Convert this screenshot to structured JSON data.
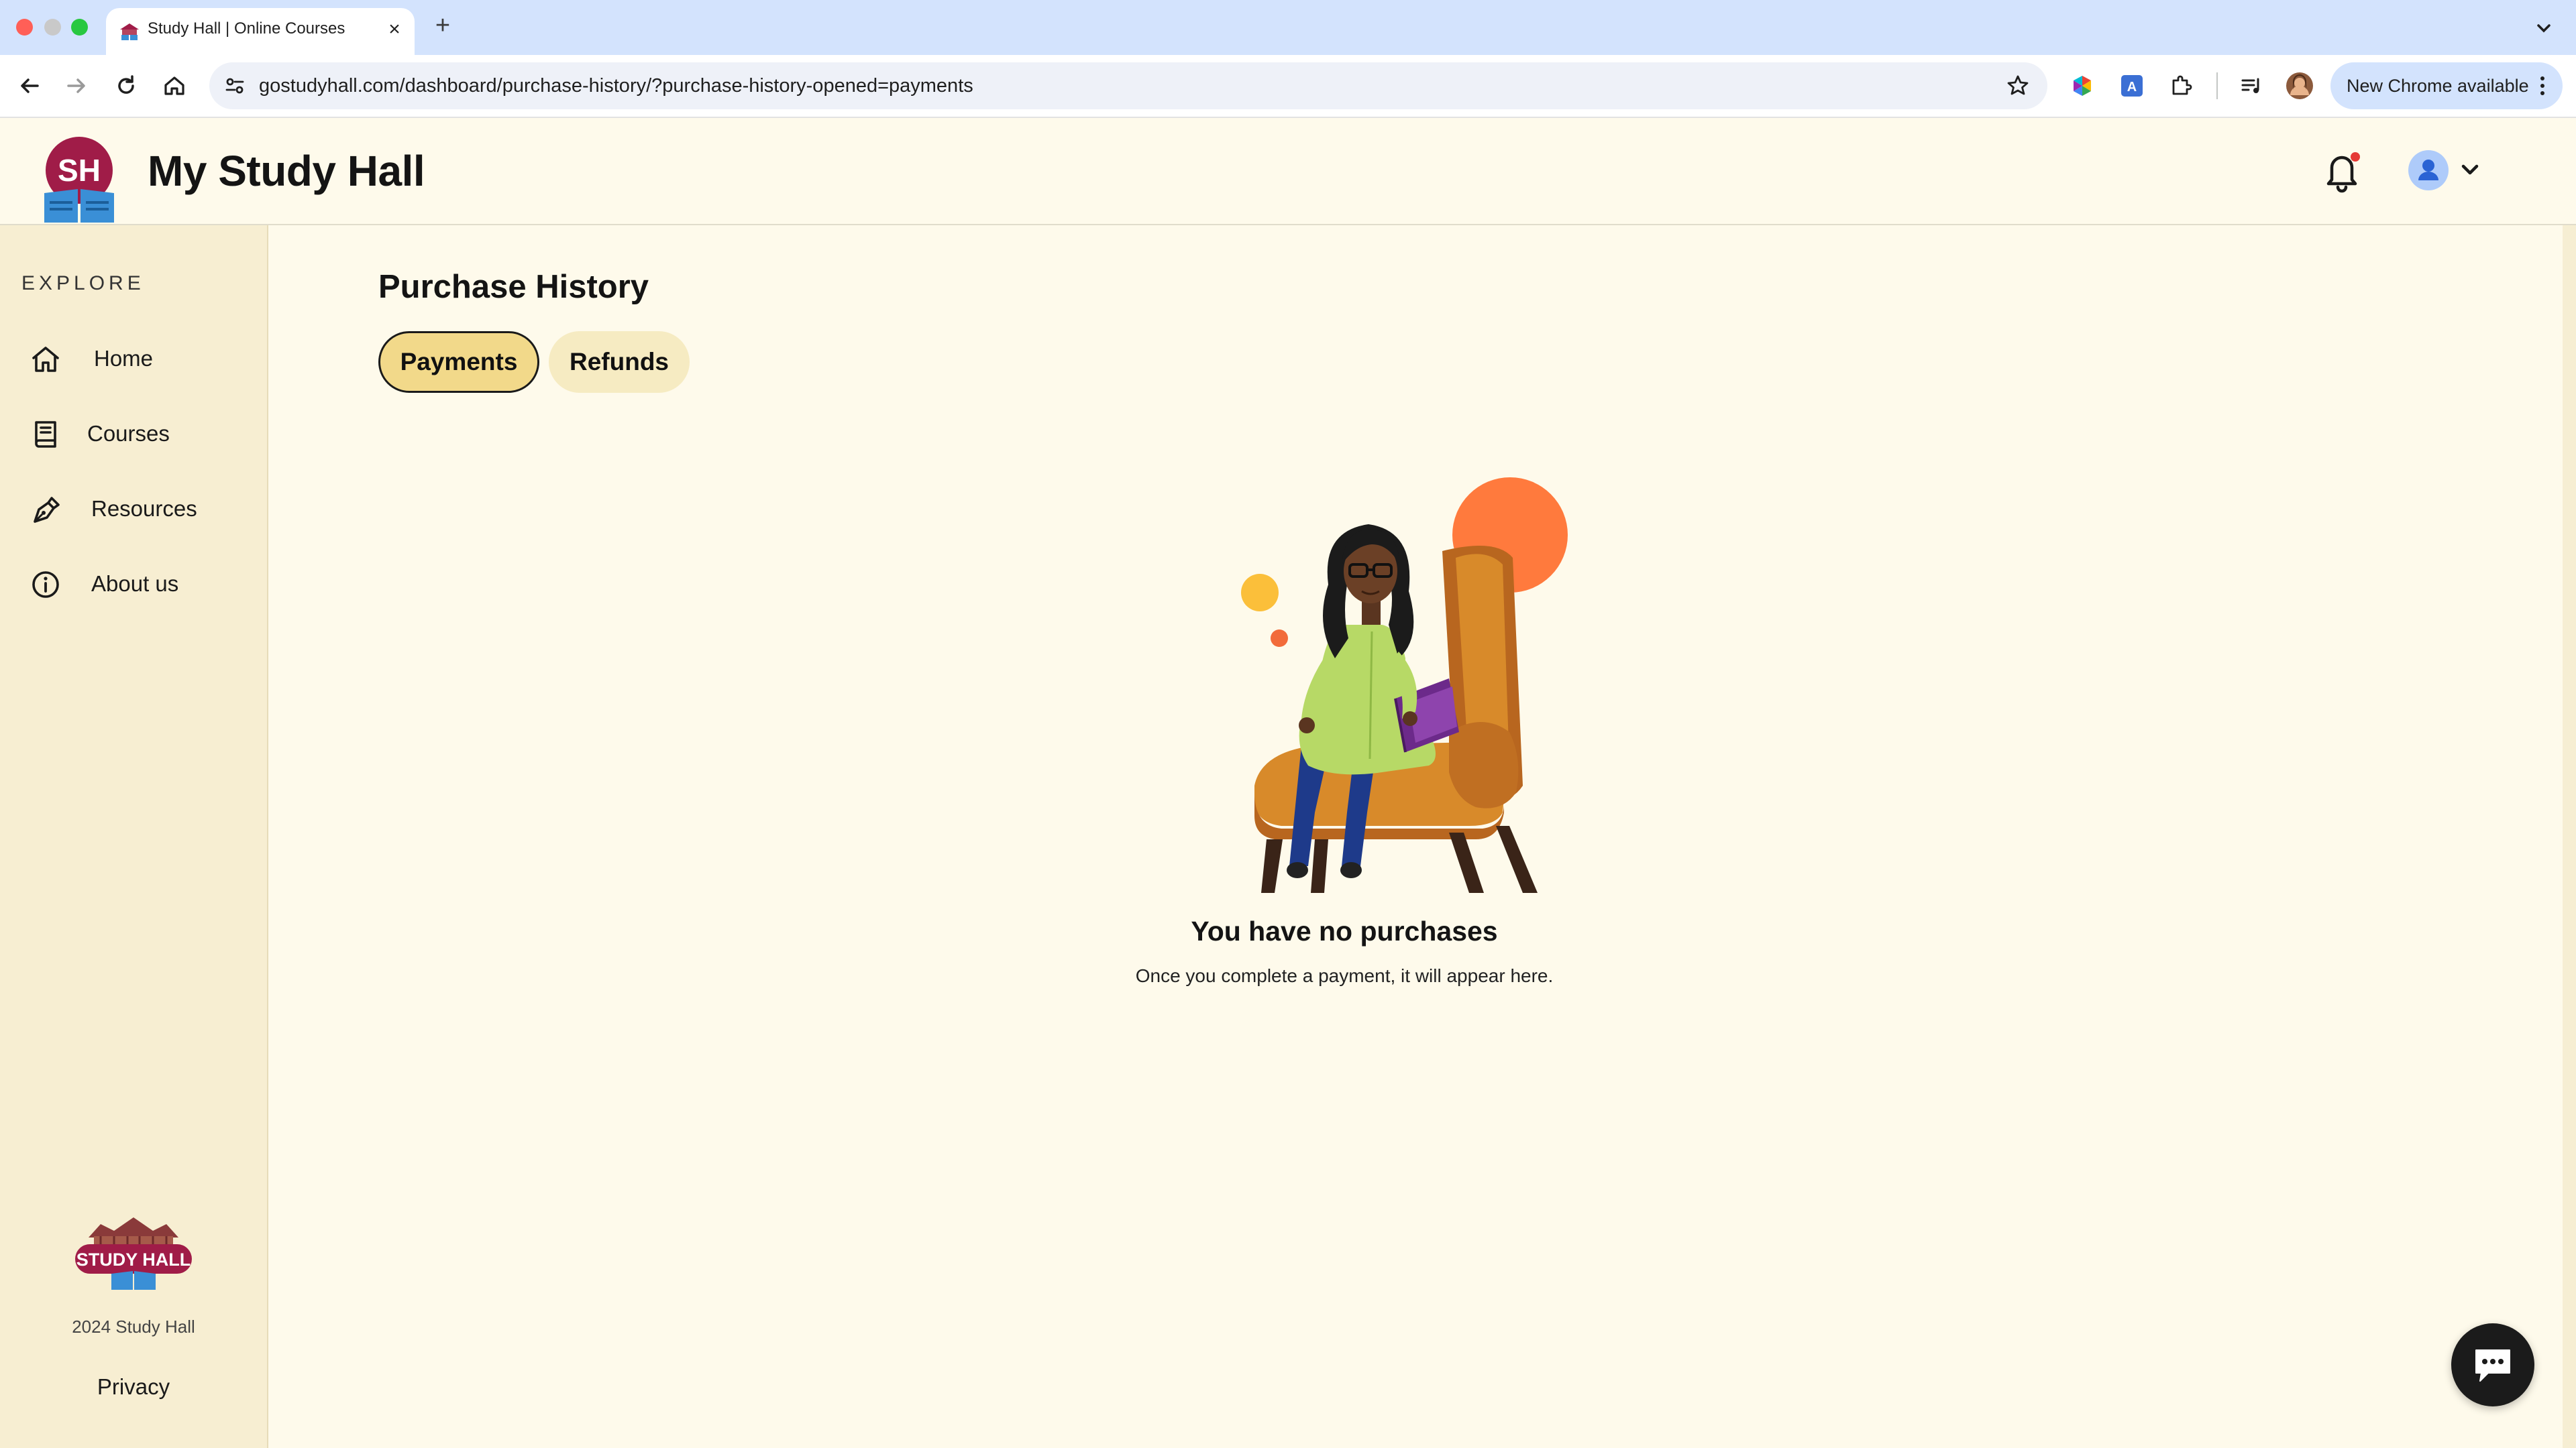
{
  "browser": {
    "tab_title": "Study Hall | Online Courses",
    "url": "gostudyhall.com/dashboard/purchase-history/?purchase-history-opened=payments",
    "update_button": "New Chrome available",
    "icons": [
      "back-icon",
      "forward-icon",
      "reload-icon",
      "home-icon",
      "site-info-icon",
      "bookmark-star-icon",
      "extension-color-icon",
      "extension-a-icon",
      "puzzle-icon",
      "media-icon",
      "profile-avatar-icon",
      "more-icon"
    ]
  },
  "header": {
    "logo_text": "SH",
    "app_title": "My Study Hall",
    "notification_dot_color": "#e53935"
  },
  "sidebar": {
    "section_label": "EXPLORE",
    "items": [
      {
        "label": "Home",
        "icon": "home-icon"
      },
      {
        "label": "Courses",
        "icon": "book-icon"
      },
      {
        "label": "Resources",
        "icon": "pen-icon"
      },
      {
        "label": "About us",
        "icon": "info-icon"
      }
    ],
    "footer_logo_text": "STUDY HALL",
    "copyright": "2024 Study Hall",
    "privacy": "Privacy"
  },
  "main": {
    "title": "Purchase History",
    "tabs": [
      {
        "label": "Payments",
        "active": true
      },
      {
        "label": "Refunds",
        "active": false
      }
    ],
    "empty_title": "You have no purchases",
    "empty_message": "Once you complete a payment, it will appear here."
  },
  "colors": {
    "brand": "#a01c48",
    "header_bg": "#fefaeb",
    "sidebar_bg": "#f7eed2",
    "active_tab": "#f2d98a",
    "inactive_tab": "#f6ebc2"
  }
}
